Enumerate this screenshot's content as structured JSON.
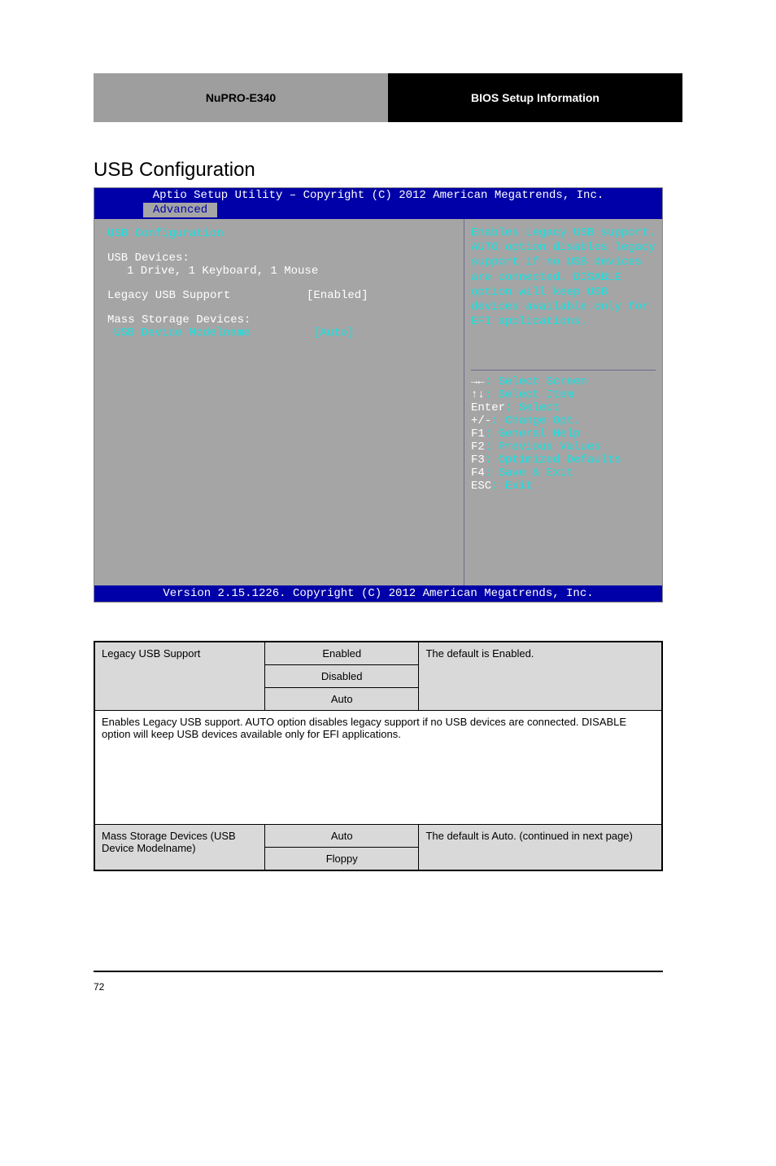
{
  "header": {
    "left": "NuPRO-E340",
    "right": "BIOS Setup Information"
  },
  "section_title": "USB Configuration",
  "bios": {
    "title_bar": "Aptio Setup Utility – Copyright (C) 2012 American Megatrends, Inc.",
    "tab": "Advanced",
    "left": {
      "usb_config": "USB Configuration",
      "usb_devices": "USB Devices:",
      "usb_devices_list": "1 Drive, 1 Keyboard, 1 Mouse",
      "legacy_label": "Legacy USB Support",
      "legacy_value": "[Enabled]",
      "mass_label": "Mass Storage Devices:",
      "mass_device": "USB Device Modelname",
      "mass_value": "[Auto]"
    },
    "right": {
      "help": "Enables Legacy USB support. AUTO option disables legacy support if no USB devices are connected. DISABLE option will keep USB devices available only for EFI applications.",
      "keys": {
        "l1p": "→←",
        "l1t": ": Select Screen",
        "l2p": "↑↓",
        "l2t": ": Select Item",
        "l3p": "Enter",
        "l3t": ": Select",
        "l4p": "+/-",
        "l4t": ": Change Opt.",
        "l5p": "F1",
        "l5t": ": General Help",
        "l6p": "F2",
        "l6t": ": Previous Values",
        "l7p": "F3",
        "l7t": ": Optimized Defaults",
        "l8p": "F4",
        "l8t": ": Save & Exit",
        "l9p": "ESC",
        "l9t": ": Exit"
      }
    },
    "footer": "Version 2.15.1226. Copyright (C) 2012 American Megatrends, Inc."
  },
  "table": {
    "r1": {
      "label": "Legacy USB Support",
      "opts": [
        "Enabled",
        "Disabled",
        "Auto"
      ],
      "desc": "The default is Enabled."
    },
    "r2": {
      "span": "Enables Legacy USB support. AUTO option disables legacy support if no USB devices are connected. DISABLE option will keep USB devices available only for EFI applications."
    },
    "r3": {
      "label": "Mass Storage Devices (USB Device Modelname)",
      "opts": [
        "Auto",
        "Floppy"
      ],
      "desc": "The default is Auto. (continued in next page)"
    }
  },
  "page_number": "72"
}
